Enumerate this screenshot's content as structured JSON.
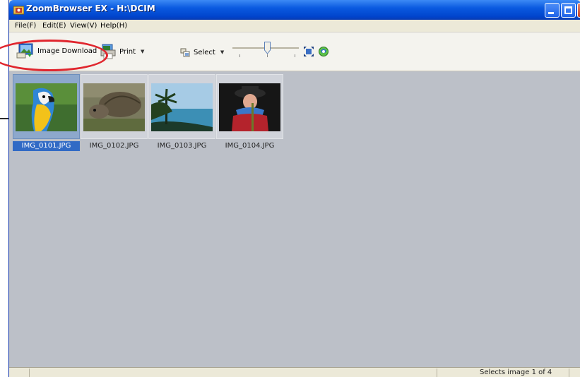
{
  "window": {
    "title": "ZoomBrowser EX - H:\\DCIM"
  },
  "menu": [
    {
      "label": "File(F)"
    },
    {
      "label": "Edit(E)"
    },
    {
      "label": "View(V)"
    },
    {
      "label": "Help(H)"
    }
  ],
  "toolbar": {
    "image_download_label": "Image Download",
    "print_label": "Print",
    "select_label": "Select"
  },
  "thumbnails": [
    {
      "name": "IMG_0101.JPG",
      "selected": true
    },
    {
      "name": "IMG_0102.JPG",
      "selected": false
    },
    {
      "name": "IMG_0103.JPG",
      "selected": false
    },
    {
      "name": "IMG_0104.JPG",
      "selected": false
    }
  ],
  "status": {
    "text": "Selects image 1 of 4"
  },
  "colors": {
    "selection": "#316ac5",
    "titlebar": "#0a5ae0",
    "content_bg": "#bcc0c8",
    "highlight_ring": "#e0262e"
  }
}
